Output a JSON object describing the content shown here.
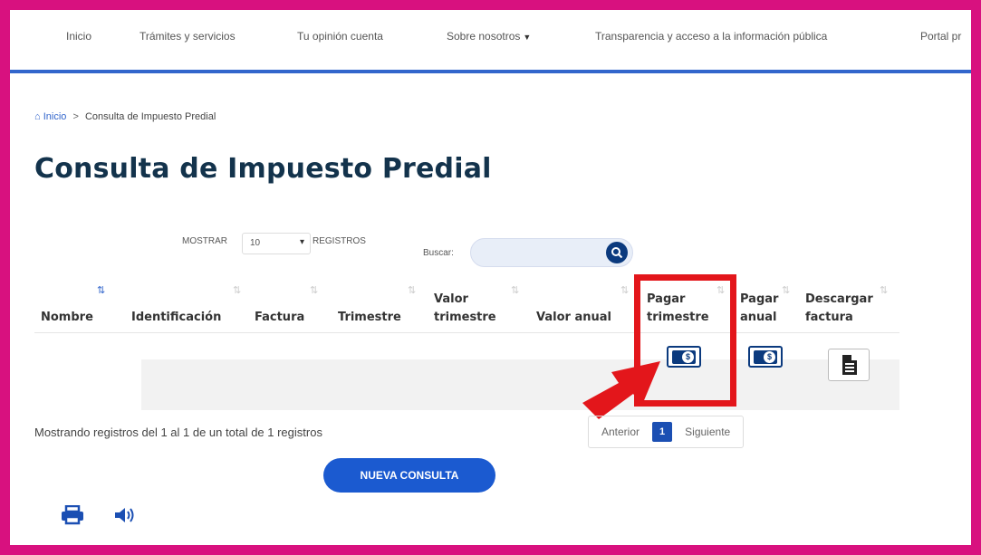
{
  "nav": {
    "items": [
      "Inicio",
      "Trámites y servicios",
      "Tu opinión cuenta",
      "Sobre nosotros",
      "Transparencia y acceso a la información pública",
      "Portal pr"
    ]
  },
  "breadcrumb": {
    "home": "Inicio",
    "separator": ">",
    "current": "Consulta de Impuesto Predial"
  },
  "page_title": "Consulta de Impuesto Predial",
  "controls": {
    "show_label": "MOSTRAR",
    "page_size": "10",
    "records_label": "REGISTROS",
    "search_label": "Buscar:",
    "search_value": ""
  },
  "table": {
    "headers": [
      [
        "Nombre"
      ],
      [
        "Identificación"
      ],
      [
        "Factura"
      ],
      [
        "Trimestre"
      ],
      [
        "Valor",
        "trimestre"
      ],
      [
        "Valor anual"
      ],
      [
        "Pagar",
        "trimestre"
      ],
      [
        "Pagar",
        "anual"
      ],
      [
        "Descargar",
        "factura"
      ]
    ],
    "row_actions": [
      "pay-quarter-icon",
      "pay-annual-icon",
      "document-icon"
    ]
  },
  "footer": {
    "info": "Mostrando registros del 1 al 1 de un total de 1 registros",
    "prev": "Anterior",
    "page": "1",
    "next": "Siguiente",
    "new_query": "NUEVA CONSULTA"
  },
  "colors": {
    "frame": "#d8117f",
    "highlight": "#e3161b",
    "primary": "#1b5ad0",
    "navy": "#0b3a7e"
  }
}
